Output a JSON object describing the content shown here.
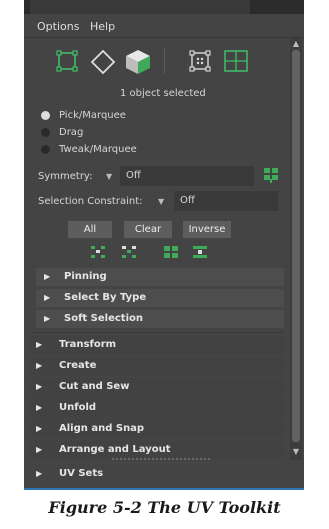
{
  "menu": {
    "options": "Options",
    "help": "Help"
  },
  "toolbar_icons": [
    "select-square-icon",
    "select-diamond-icon",
    "select-cube-icon",
    "select-dotted-square-icon",
    "select-grid-icon"
  ],
  "status": "1 object selected",
  "tools": [
    {
      "label": "Pick/Marquee",
      "selected": true
    },
    {
      "label": "Drag",
      "selected": false
    },
    {
      "label": "Tweak/Marquee",
      "selected": false
    }
  ],
  "symmetry": {
    "label": "Symmetry:",
    "value": "Off"
  },
  "selection_constraint": {
    "label": "Selection Constraint:",
    "value": "Off"
  },
  "buttons": {
    "all": "All",
    "clear": "Clear",
    "inverse": "Inverse"
  },
  "sub_sections": [
    {
      "title": "Pinning"
    },
    {
      "title": "Select By Type"
    },
    {
      "title": "Soft Selection"
    }
  ],
  "rollouts": [
    {
      "title": "Transform"
    },
    {
      "title": "Create"
    },
    {
      "title": "Cut and Sew"
    },
    {
      "title": "Unfold"
    },
    {
      "title": "Align and Snap"
    },
    {
      "title": "Arrange and Layout"
    },
    {
      "title": "UV Sets"
    }
  ],
  "caption": "Figure 5-2  The UV Toolkit",
  "colors": {
    "panel": "#444444",
    "accent_green": "#3faa5a",
    "accent_blue": "#2f74b7"
  }
}
